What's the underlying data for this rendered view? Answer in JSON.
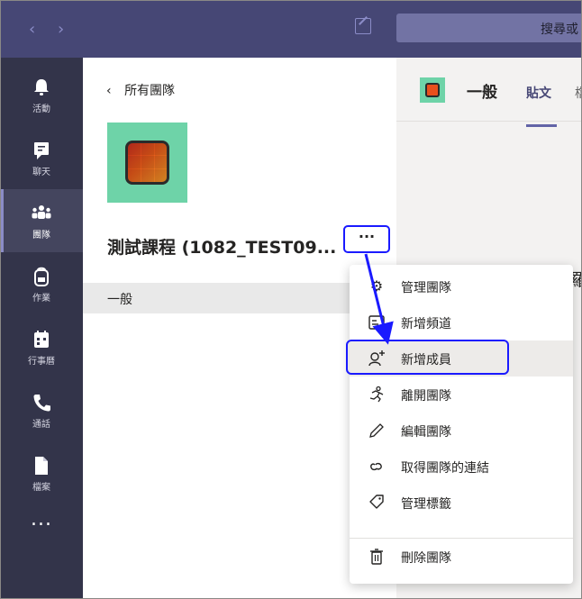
{
  "topbar": {
    "back_icon": "chevron-left-icon",
    "forward_icon": "chevron-right-icon",
    "compose_icon": "compose-icon",
    "search_placeholder": "搜尋或"
  },
  "rail": {
    "items": [
      {
        "label": "活動",
        "icon": "bell-icon"
      },
      {
        "label": "聊天",
        "icon": "chat-icon"
      },
      {
        "label": "團隊",
        "icon": "teams-icon",
        "active": true
      },
      {
        "label": "作業",
        "icon": "backpack-icon"
      },
      {
        "label": "行事曆",
        "icon": "calendar-icon"
      },
      {
        "label": "通話",
        "icon": "phone-icon"
      },
      {
        "label": "檔案",
        "icon": "file-icon"
      }
    ],
    "more": "..."
  },
  "pane": {
    "back_label": "所有團隊",
    "team_name": "測試課程 (1082_TEST09...",
    "more_button": "···",
    "channel": "一般"
  },
  "main": {
    "title": "一般",
    "tabs": [
      "貼文",
      "檔"
    ],
    "clipped_text": "羅"
  },
  "menu": {
    "items": [
      {
        "label": "管理團隊",
        "icon": "gear-icon"
      },
      {
        "label": "新增頻道",
        "icon": "add-channel-icon"
      },
      {
        "label": "新增成員",
        "icon": "add-member-icon",
        "highlighted": true
      },
      {
        "label": "離開團隊",
        "icon": "leave-icon"
      },
      {
        "label": "編輯團隊",
        "icon": "pencil-icon"
      },
      {
        "label": "取得團隊的連結",
        "icon": "link-icon"
      },
      {
        "label": "管理標籤",
        "icon": "tag-icon"
      },
      {
        "label": "刪除團隊",
        "icon": "trash-icon"
      }
    ]
  },
  "colors": {
    "topbar": "#464775",
    "rail": "#33344a",
    "accent": "#6264a7",
    "annotation": "#1a1aff",
    "team_tile": "#6ed3a8"
  }
}
